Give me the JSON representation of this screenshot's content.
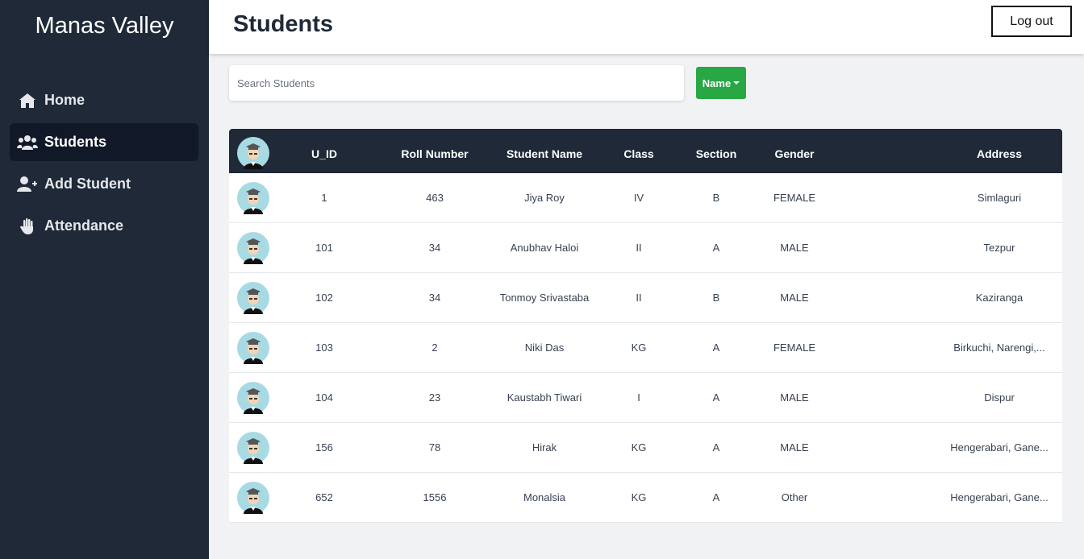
{
  "brand": "Manas Valley",
  "nav": [
    {
      "label": "Home",
      "icon": "home-icon",
      "active": false
    },
    {
      "label": "Students",
      "icon": "users-icon",
      "active": true
    },
    {
      "label": "Add Student",
      "icon": "user-plus-icon",
      "active": false
    },
    {
      "label": "Attendance",
      "icon": "hand-icon",
      "active": false
    }
  ],
  "header": {
    "title": "Students",
    "logout_label": "Log out"
  },
  "search": {
    "placeholder": "Search Students",
    "value": ""
  },
  "filter": {
    "label": "Name"
  },
  "table": {
    "columns": [
      "U_ID",
      "Roll Number",
      "Student Name",
      "Class",
      "Section",
      "Gender",
      "Address"
    ],
    "rows": [
      {
        "uid": "1",
        "roll": "463",
        "name": "Jiya Roy",
        "class": "IV",
        "section": "B",
        "gender": "FEMALE",
        "address": "Simlaguri"
      },
      {
        "uid": "101",
        "roll": "34",
        "name": "Anubhav Haloi",
        "class": "II",
        "section": "A",
        "gender": "MALE",
        "address": "Tezpur"
      },
      {
        "uid": "102",
        "roll": "34",
        "name": "Tonmoy Srivastaba",
        "class": "II",
        "section": "B",
        "gender": "MALE",
        "address": "Kaziranga"
      },
      {
        "uid": "103",
        "roll": "2",
        "name": "Niki Das",
        "class": "KG",
        "section": "A",
        "gender": "FEMALE",
        "address": "Birkuchi, Narengi,..."
      },
      {
        "uid": "104",
        "roll": "23",
        "name": "Kaustabh Tiwari",
        "class": "I",
        "section": "A",
        "gender": "MALE",
        "address": "Dispur"
      },
      {
        "uid": "156",
        "roll": "78",
        "name": "Hirak",
        "class": "KG",
        "section": "A",
        "gender": "MALE",
        "address": "Hengerabari, Gane..."
      },
      {
        "uid": "652",
        "roll": "1556",
        "name": "Monalsia",
        "class": "KG",
        "section": "A",
        "gender": "Other",
        "address": "Hengerabari, Gane..."
      }
    ]
  },
  "colors": {
    "sidebar": "#1f2937",
    "accent": "#28a745"
  }
}
